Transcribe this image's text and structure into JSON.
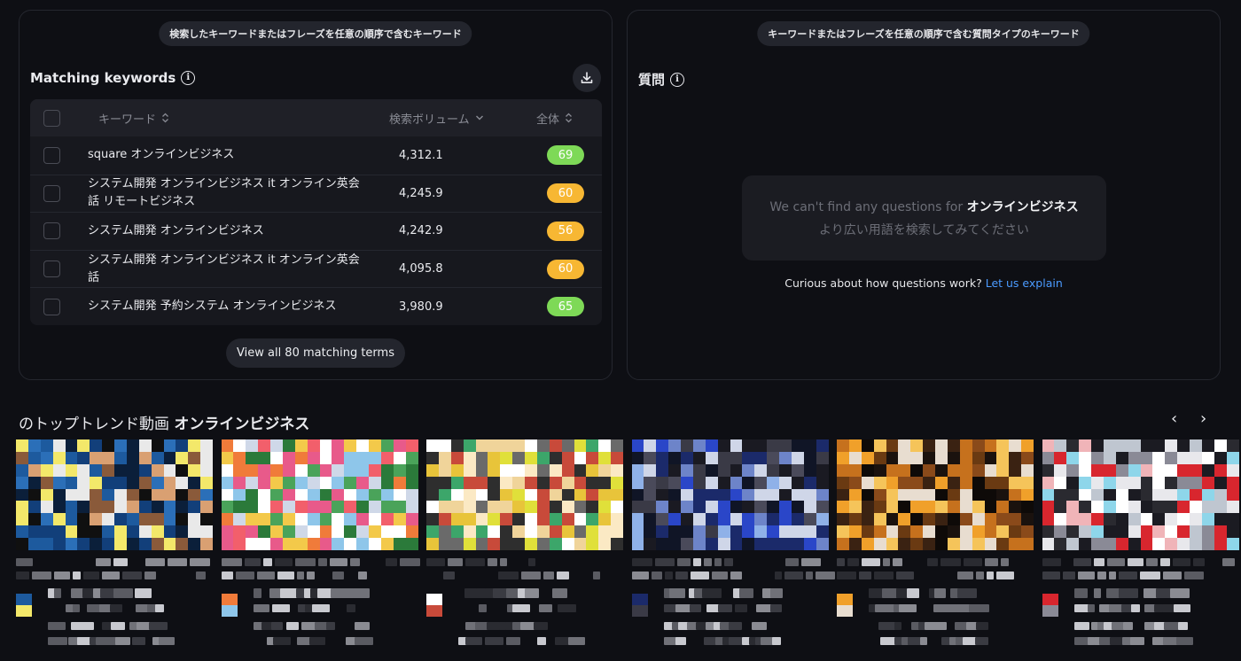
{
  "left_panel": {
    "pill": "検索したキーワードまたはフレーズを任意の順序で含むキーワード",
    "title": "Matching keywords",
    "columns": {
      "keyword": "キーワード",
      "volume": "検索ボリューム",
      "overall": "全体"
    },
    "rows": [
      {
        "keyword": "square オンラインビジネス",
        "volume": "4,312.1",
        "score": "69",
        "score_color": "#7ed957"
      },
      {
        "keyword": "システム開発 オンラインビジネス it オンライン英会話 リモートビジネス",
        "volume": "4,245.9",
        "score": "60",
        "score_color": "#f7b733"
      },
      {
        "keyword": "システム開発 オンラインビジネス",
        "volume": "4,242.9",
        "score": "56",
        "score_color": "#f7b733"
      },
      {
        "keyword": "システム開発 オンラインビジネス it オンライン英会話",
        "volume": "4,095.8",
        "score": "60",
        "score_color": "#f7b733"
      },
      {
        "keyword": "システム開発 予約システム オンラインビジネス",
        "volume": "3,980.9",
        "score": "65",
        "score_color": "#7ed957"
      }
    ],
    "view_all": "View all 80 matching terms"
  },
  "right_panel": {
    "pill": "キーワードまたはフレーズを任意の順序で含む質問タイプのキーワード",
    "title": "質問",
    "empty_prefix": "We can't find any questions for",
    "empty_term": "オンラインビジネス",
    "empty_line2": "より広い用語を検索してみてください",
    "curious_text": "Curious about how questions work?",
    "curious_link": "Let us explain"
  },
  "videos": {
    "title_prefix": "のトップトレンド動画",
    "title_term": "オンラインビジネス",
    "prev": "‹",
    "next": "›"
  }
}
